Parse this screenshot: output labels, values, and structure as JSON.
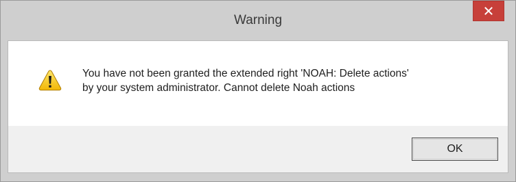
{
  "window": {
    "title": "Warning",
    "close_icon": "close-icon",
    "close_color": "#c7403a"
  },
  "message": {
    "icon": "warning-icon",
    "line1": "You have not been granted the extended right 'NOAH: Delete actions'",
    "line2": "by your system administrator. Cannot delete Noah actions"
  },
  "buttons": {
    "ok_label": "OK"
  }
}
